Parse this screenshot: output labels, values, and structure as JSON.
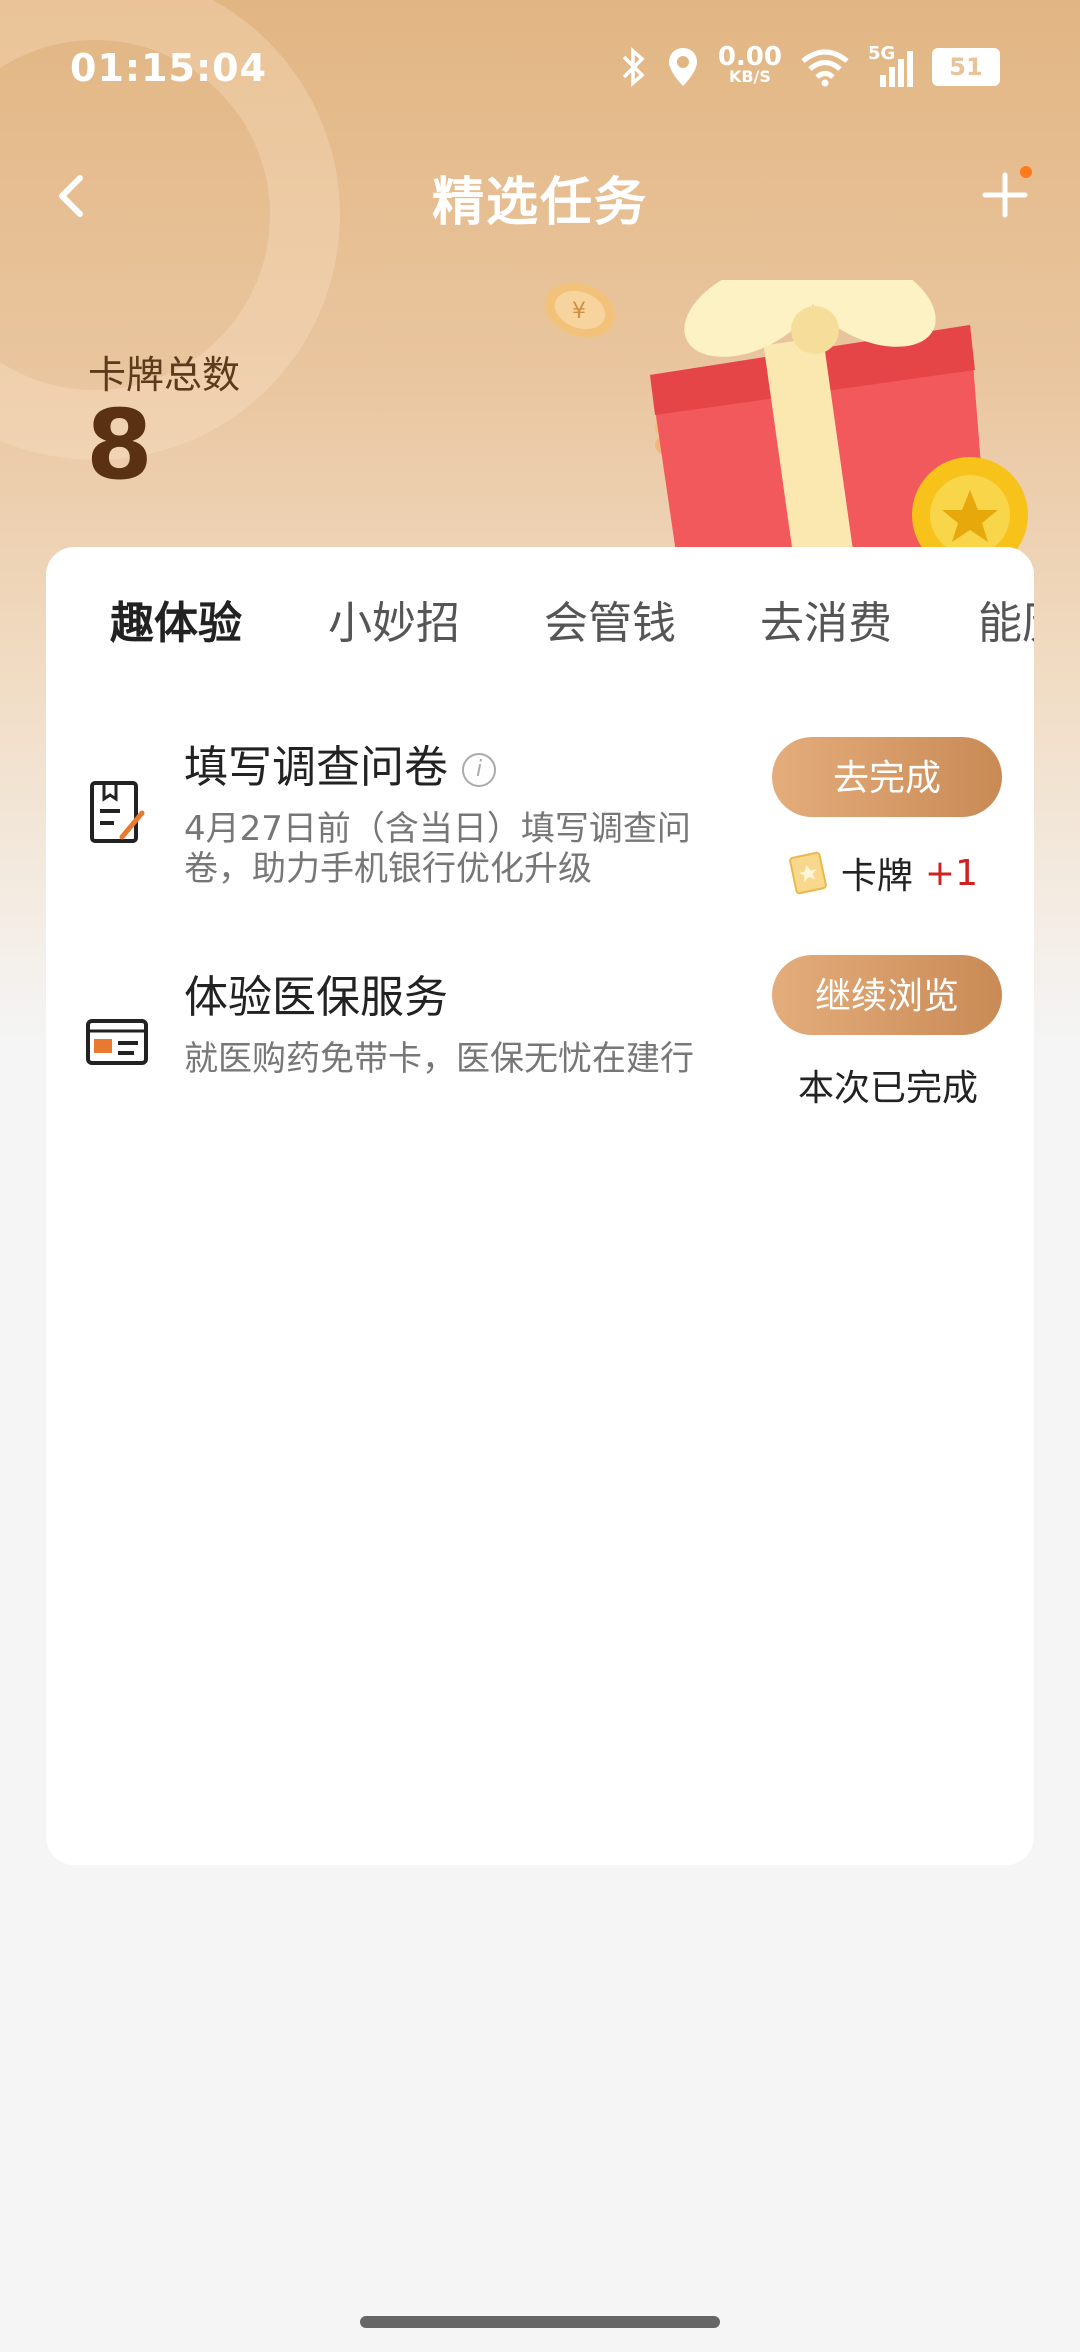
{
  "status_bar": {
    "time": "01:15:04",
    "net_speed_value": "0.00",
    "net_speed_unit": "KB/S",
    "network": "5G",
    "battery": "51"
  },
  "nav": {
    "title": "精选任务"
  },
  "summary": {
    "label": "卡牌总数",
    "count": "8"
  },
  "tabs": [
    "趣体验",
    "小妙招",
    "会管钱",
    "去消费",
    "能历"
  ],
  "active_tab": "趣体验",
  "tasks": [
    {
      "title": "填写调查问卷",
      "desc_line1": "4月27日前（含当日）填写调查问",
      "desc_line2": "卷，助力手机银行优化升级",
      "button": "去完成",
      "reward_label": "卡牌",
      "reward_value": "+1"
    },
    {
      "title": "体验医保服务",
      "desc_line1": "就医购药免带卡，医保无忧在建行",
      "button": "继续浏览",
      "status": "本次已完成"
    }
  ],
  "colors": {
    "accent": "#d08f5a",
    "hero_top": "#e2b683",
    "reward_plus": "#d02020"
  }
}
